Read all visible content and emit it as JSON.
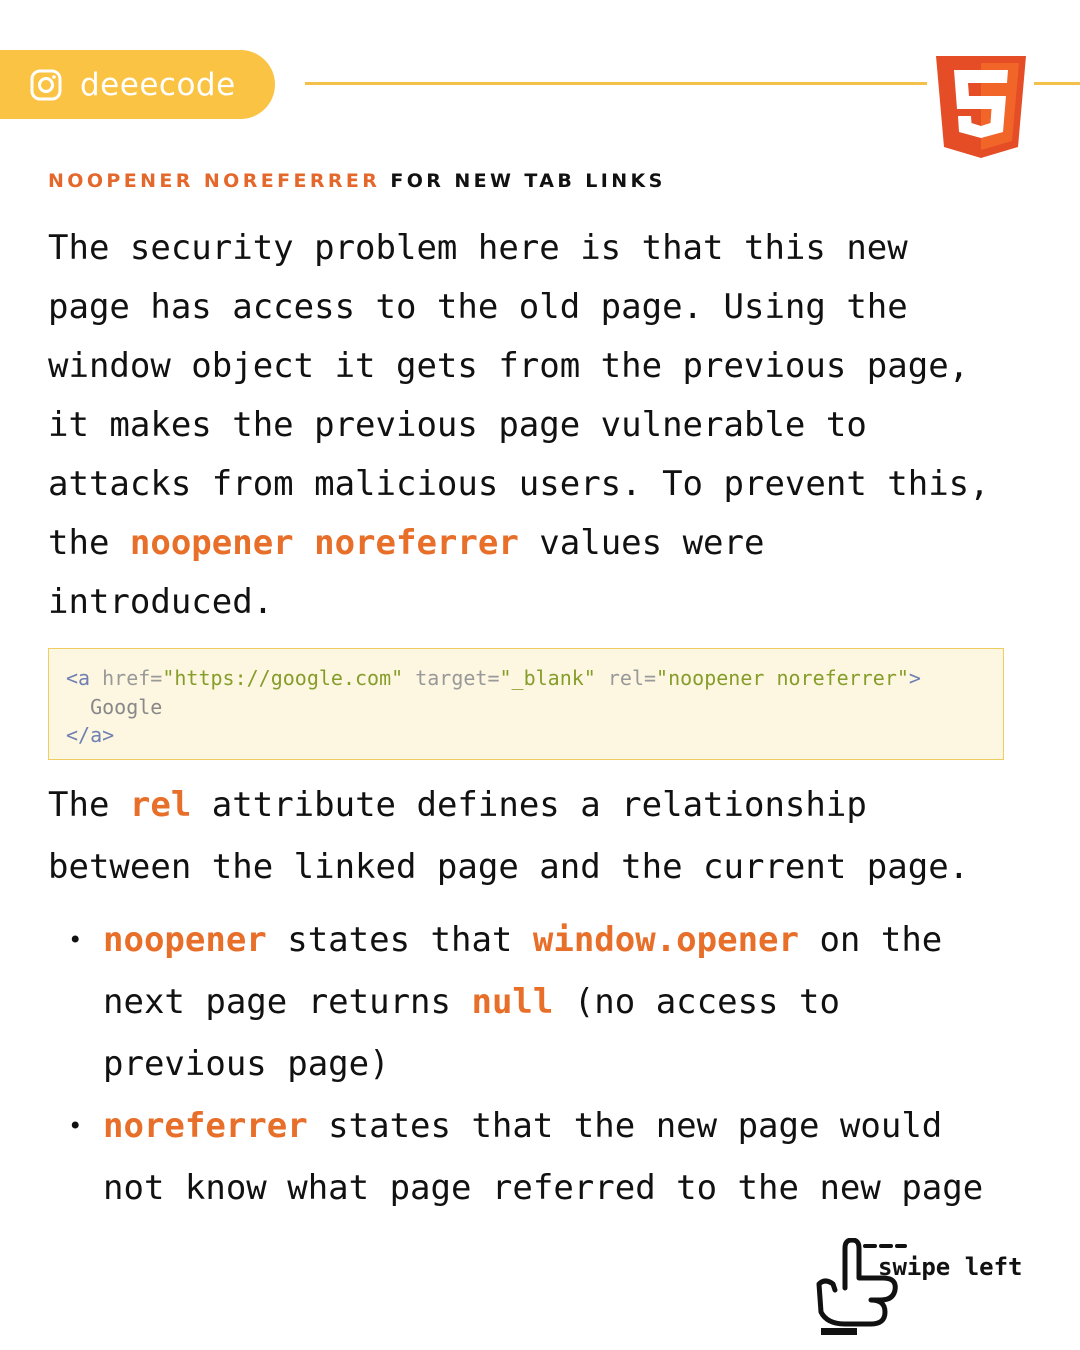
{
  "header": {
    "handle": "deeecode",
    "instagram_icon": "instagram-icon",
    "logo_icon": "html5-logo-icon"
  },
  "heading": {
    "accent": "NOOPENER NOREFERRER",
    "rest": "FOR NEW TAB LINKS"
  },
  "paragraph1": {
    "lines": [
      "The security problem here is that this new",
      "page has access to the old page. Using the",
      "window object it gets from the previous page,",
      "it makes the previous page vulnerable to",
      "attacks from malicious users. To prevent this,"
    ],
    "line6_pre": "the ",
    "line6_hl": "noopener noreferrer",
    "line6_post": " values were",
    "line7": "introduced."
  },
  "code": {
    "open_tag": "<a",
    "href_attr": " href=",
    "href_val": "\"https://google.com\"",
    "target_attr": " target=",
    "target_val": "\"_blank\"",
    "rel_attr": " rel=",
    "rel_val": "\"noopener noreferrer\"",
    "open_end": ">",
    "inner": "  Google",
    "close_tag": "</a>"
  },
  "paragraph2": {
    "pre": "The ",
    "hl": "rel",
    "post": " attribute defines a relationship",
    "line2": "between the linked page and the current page."
  },
  "bullets": [
    {
      "l1_hl1": "noopener",
      "l1_mid": " states that ",
      "l1_hl2": "window.opener",
      "l1_post": " on the",
      "l2_pre": "next page returns ",
      "l2_hl": "null",
      "l2_post": " (no access to",
      "l3": "previous page)"
    },
    {
      "l1_hl": "noreferrer",
      "l1_post": " states that the new page would",
      "l2": "not know what page referred to the new page"
    }
  ],
  "footer": {
    "swipe_label": "swipe left",
    "swipe_icon": "swipe-hand-icon"
  },
  "colors": {
    "accent": "#e76f2a",
    "pill": "#fbc343",
    "code_bg": "#fdf7e2",
    "html5_orange": "#e44d26"
  }
}
